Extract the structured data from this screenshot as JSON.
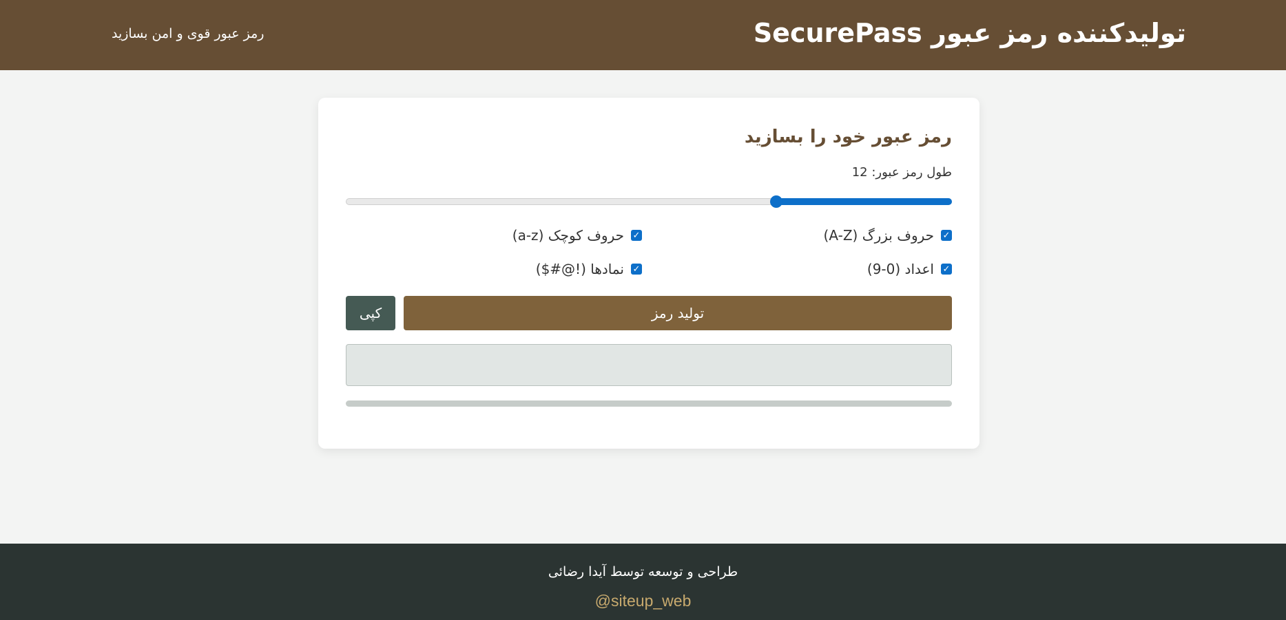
{
  "header": {
    "title": "تولیدکننده رمز عبور SecurePass",
    "tagline": "رمز عبور قوی و امن بسازید"
  },
  "generator": {
    "heading": "رمز عبور خود را بسازید",
    "length_label": "طول رمز عبور: 12",
    "length_value": 12,
    "length_fraction": 0.29,
    "options": {
      "uppercase": {
        "label": "حروف بزرگ (A-Z)",
        "checked": true
      },
      "lowercase": {
        "label": "حروف کوچک (a-z)",
        "checked": true
      },
      "numbers": {
        "label": "اعداد (0-9)",
        "checked": true
      },
      "symbols": {
        "label": "نمادها (!@#$)",
        "checked": true
      }
    },
    "generate_label": "تولید رمز",
    "copy_label": "کپی",
    "password_value": "",
    "strength_fraction": 0
  },
  "footer": {
    "credit": "طراحی و توسعه توسط آیدا رضائی",
    "handle": "siteup_web@"
  },
  "colors": {
    "brand_brown": "#664e34",
    "button_brown": "#7f623b",
    "accent_blue": "#0d6fc9",
    "copy_button": "#455a54",
    "footer_bg": "#2b3432",
    "footer_link": "#c8aa6e"
  }
}
